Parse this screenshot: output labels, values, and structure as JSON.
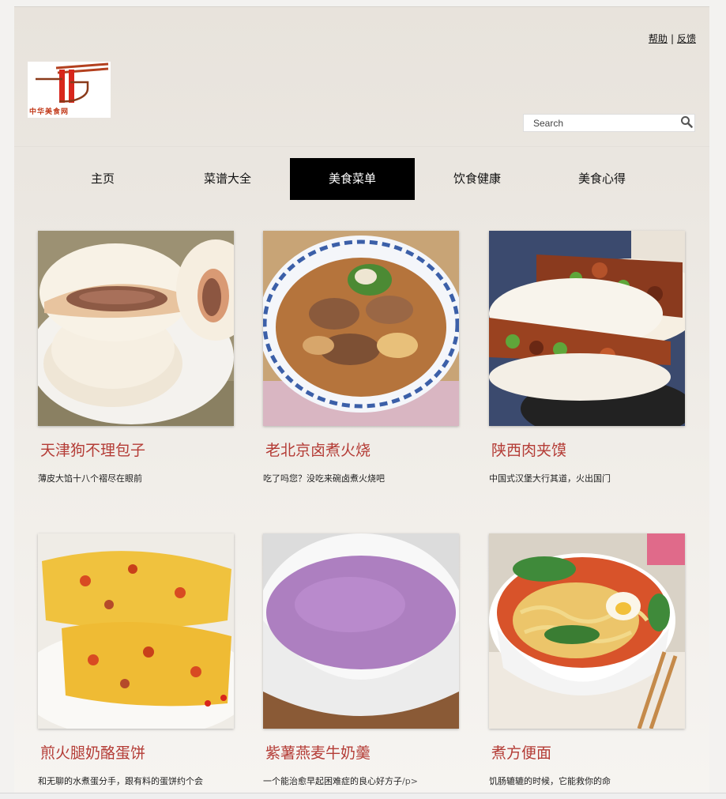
{
  "header": {
    "links": [
      "帮助",
      "反馈"
    ],
    "separator": "|",
    "logo_text": "中华美食网",
    "search_placeholder": "Search"
  },
  "nav": {
    "items": [
      "主页",
      "菜谱大全",
      "美食菜单",
      "饮食健康",
      "美食心得"
    ],
    "active_index": 2
  },
  "cards": [
    {
      "title": "天津狗不理包子",
      "desc": "薄皮大馅十八个褶尽在眼前",
      "image": "steamed-buns"
    },
    {
      "title": "老北京卤煮火烧",
      "desc": "吃了吗您？没吃来碗卤煮火烧吧",
      "image": "braised-offal-bowl"
    },
    {
      "title": "陕西肉夹馍",
      "desc": "中国式汉堡大行其道，火出国门",
      "image": "chinese-burger"
    },
    {
      "title": "煎火腿奶酪蛋饼",
      "desc": "和无聊的水煮蛋分手，跟有料的蛋饼约个会",
      "image": "ham-cheese-omelette"
    },
    {
      "title": "紫薯燕麦牛奶羹",
      "desc": "一个能治愈早起困难症的良心好方子",
      "desc_tail": "/p>",
      "image": "purple-potato-soup"
    },
    {
      "title": "煮方便面",
      "desc": "饥肠辘辘的时候，它能救你的命",
      "image": "instant-noodles"
    }
  ],
  "colors": {
    "title_red": "#b43c36",
    "nav_active_bg": "#000000",
    "logo_red": "#c23a1a"
  }
}
